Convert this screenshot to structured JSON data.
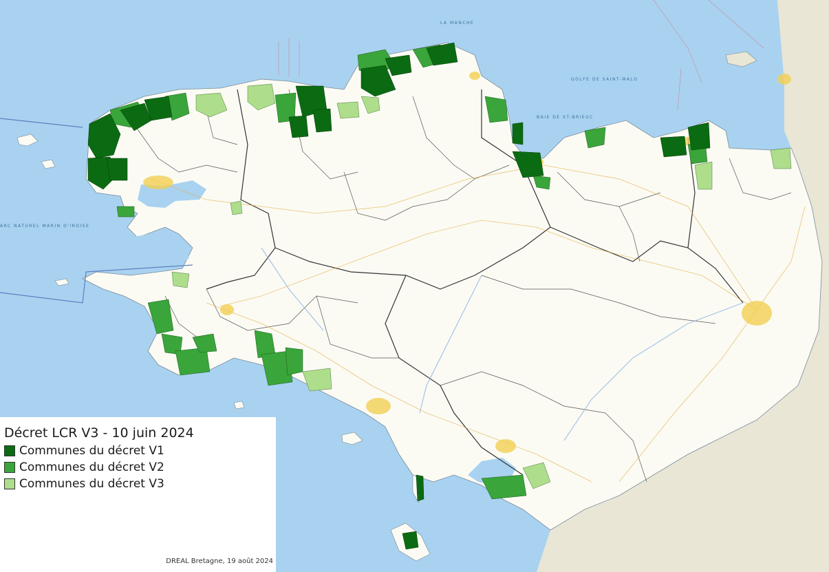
{
  "legend": {
    "title": "Décret LCR V3 - 10 juin 2024",
    "items": [
      {
        "label": "Communes du décret V1",
        "color": "#0b6b12"
      },
      {
        "label": "Communes du décret V2",
        "color": "#3aa53a"
      },
      {
        "label": "Communes du décret V3",
        "color": "#aedd8c"
      }
    ]
  },
  "credit": "DREAL Bretagne, 19 août 2024",
  "colors": {
    "sea": "#a9d2f0",
    "land": "#fbfbf4",
    "outside_region": "#e6e4d2",
    "v1": "#0b6b12",
    "v2": "#3aa53a",
    "v3": "#aedd8c",
    "urban": "#f2cf52"
  }
}
